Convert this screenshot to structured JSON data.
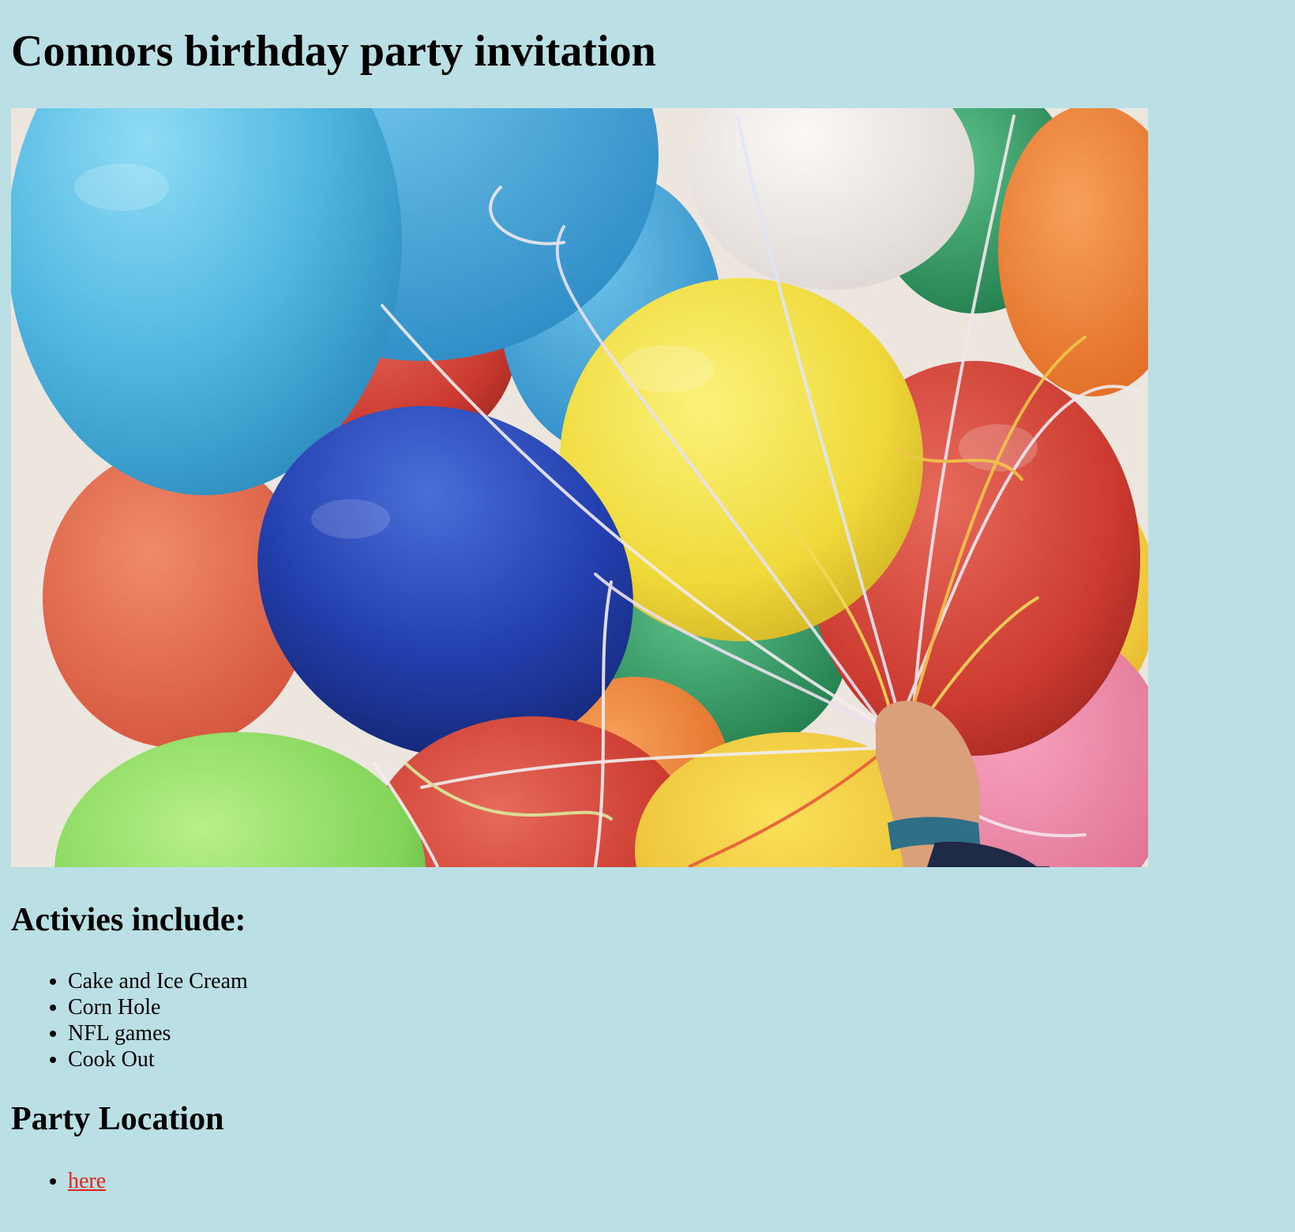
{
  "page": {
    "title": "Connors birthday party invitation",
    "background_color": "#bae0e6"
  },
  "hero_image": {
    "description_icon": "balloons-photo"
  },
  "activities": {
    "heading": "Activies include:",
    "items": [
      "Cake and Ice Cream",
      "Corn Hole",
      "NFL games",
      "Cook Out"
    ]
  },
  "location": {
    "heading": "Party Location",
    "link_label": "here",
    "link_color": "#e0231d"
  }
}
